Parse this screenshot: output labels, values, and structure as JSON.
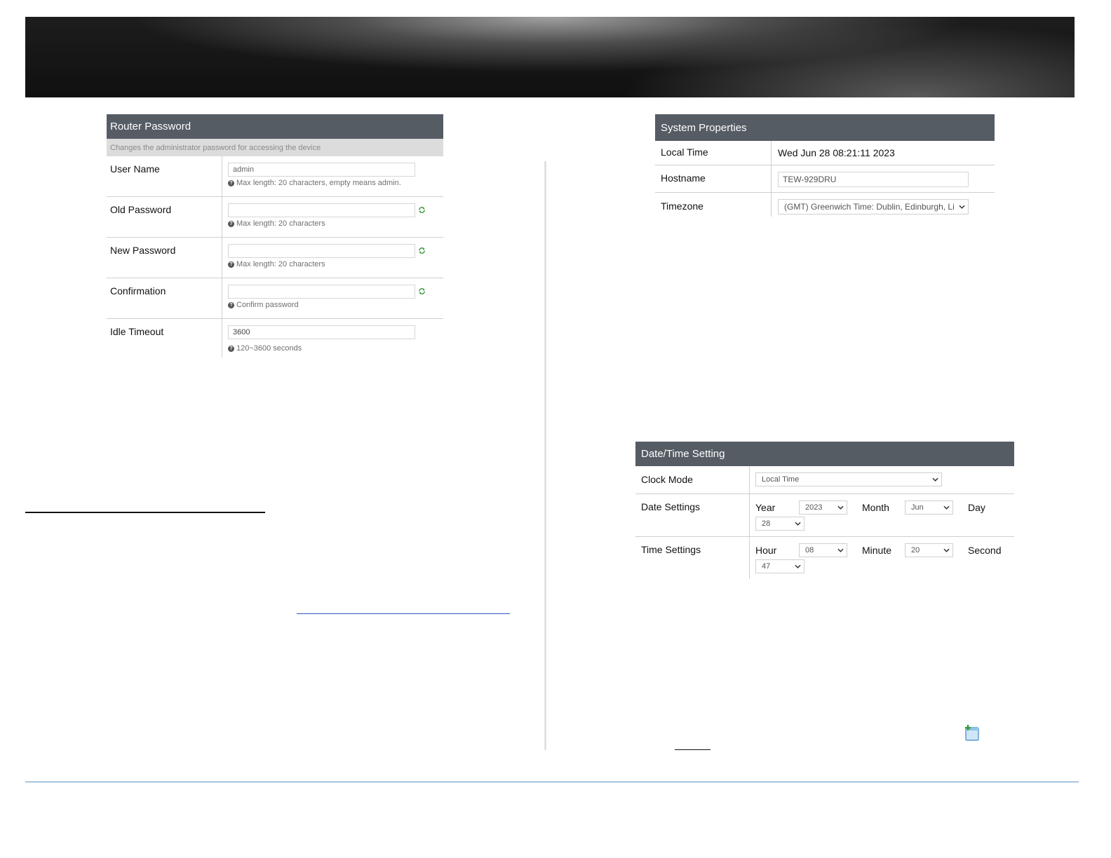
{
  "router_password": {
    "title": "Router Password",
    "subtitle": "Changes the administrator password for accessing the device",
    "rows": [
      {
        "label": "User Name",
        "value": "admin",
        "hint": "Max length: 20 characters, empty means admin."
      },
      {
        "label": "Old Password",
        "value": "",
        "hint": "Max length: 20 characters"
      },
      {
        "label": "New Password",
        "value": "",
        "hint": "Max length: 20 characters"
      },
      {
        "label": "Confirmation",
        "value": "",
        "hint": "Confirm password"
      },
      {
        "label": "Idle Timeout",
        "value": "3600",
        "hint": "120~3600 seconds"
      }
    ]
  },
  "system_properties": {
    "title": "System Properties",
    "local_time_label": "Local Time",
    "local_time_value": "Wed Jun 28 08:21:11 2023",
    "hostname_label": "Hostname",
    "hostname_value": "TEW-929DRU",
    "timezone_label": "Timezone",
    "timezone_value": "(GMT) Greenwich Time: Dublin, Edinburgh, Li"
  },
  "datetime_setting": {
    "title": "Date/Time Setting",
    "clock_mode_label": "Clock Mode",
    "clock_mode_value": "Local Time",
    "date_label": "Date Settings",
    "year_label": "Year",
    "year_value": "2023",
    "month_label": "Month",
    "month_value": "Jun",
    "day_label": "Day",
    "day_value": "28",
    "time_label": "Time Settings",
    "hour_label": "Hour",
    "hour_value": "08",
    "minute_label": "Minute",
    "minute_value": "20",
    "second_label": "Second",
    "second_value": "47"
  },
  "icons": {
    "generate": "refresh-key-icon",
    "help": "question-circle-icon",
    "add_page": "add-document-icon",
    "dropdown": "chevron-down-icon"
  },
  "colors": {
    "panel_header": "#565c64",
    "subheader": "#dcdcdc",
    "footer_rule": "#5a93c9",
    "generate_icon": "#3a9a3a",
    "link_rule": "#2c58c8"
  }
}
